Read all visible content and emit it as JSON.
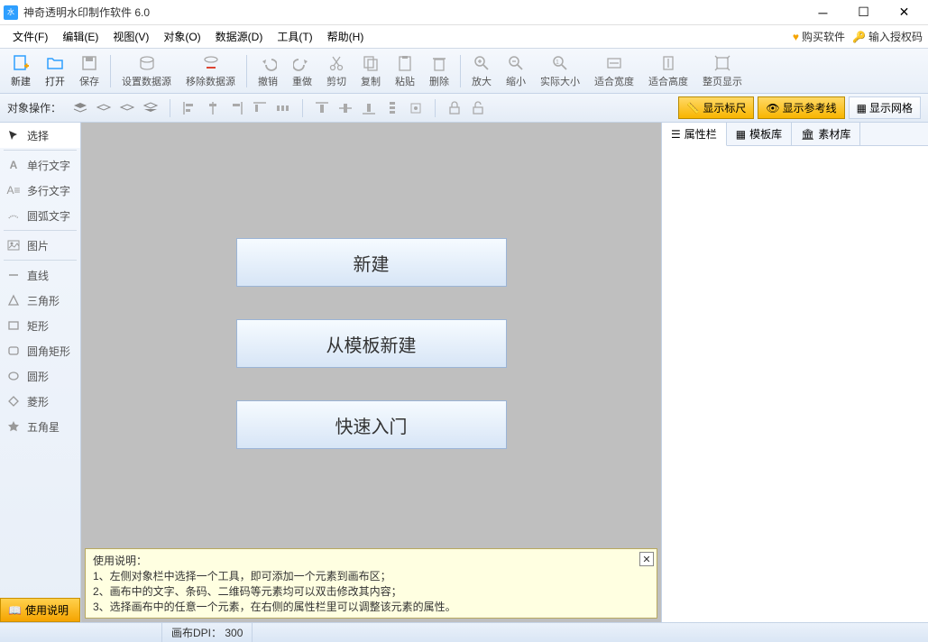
{
  "title": "神奇透明水印制作软件 6.0",
  "menu": [
    "文件(F)",
    "编辑(E)",
    "视图(V)",
    "对象(O)",
    "数据源(D)",
    "工具(T)",
    "帮助(H)"
  ],
  "buy": "购买软件",
  "license": "输入授权码",
  "toolbar": [
    "新建",
    "打开",
    "保存",
    "设置数据源",
    "移除数据源",
    "撤销",
    "重做",
    "剪切",
    "复制",
    "粘贴",
    "删除",
    "放大",
    "缩小",
    "实际大小",
    "适合宽度",
    "适合高度",
    "整页显示"
  ],
  "optlabel": "对象操作：",
  "toggles": {
    "ruler": "显示标尺",
    "guide": "显示参考线",
    "grid": "显示网格"
  },
  "tools": [
    "选择",
    "单行文字",
    "多行文字",
    "圆弧文字",
    "图片",
    "直线",
    "三角形",
    "矩形",
    "圆角矩形",
    "圆形",
    "菱形",
    "五角星"
  ],
  "helpTab": "使用说明",
  "bigbtns": [
    "新建",
    "从模板新建",
    "快速入门"
  ],
  "help": {
    "title": "使用说明：",
    "l1": "1、左侧对象栏中选择一个工具，即可添加一个元素到画布区；",
    "l2": "2、画布中的文字、条码、二维码等元素均可以双击修改其内容；",
    "l3": "3、选择画布中的任意一个元素，在右侧的属性栏里可以调整该元素的属性。"
  },
  "tabs": [
    "属性栏",
    "模板库",
    "素材库"
  ],
  "status": {
    "dpi": "画布DPI：",
    "dpival": "300"
  }
}
